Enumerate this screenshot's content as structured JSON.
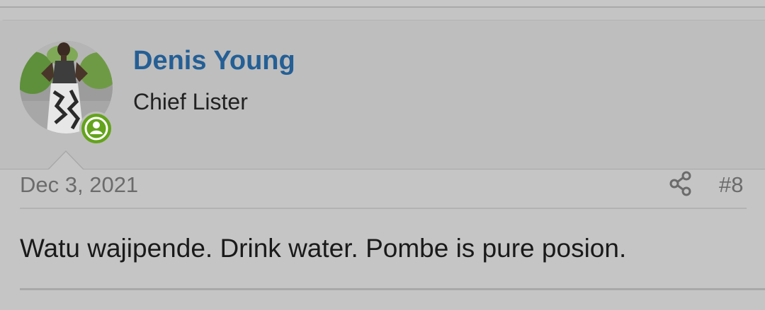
{
  "post": {
    "author": {
      "name": "Denis Young",
      "title": "Chief Lister",
      "status": "online",
      "status_color": "#64a31c",
      "name_color": "#245f95"
    },
    "date": "Dec 3, 2021",
    "post_number": "#8",
    "message": "Watu wajipende. Drink water. Pombe is pure posion.",
    "icons": {
      "share": "share-icon",
      "status": "user-online-icon"
    }
  }
}
